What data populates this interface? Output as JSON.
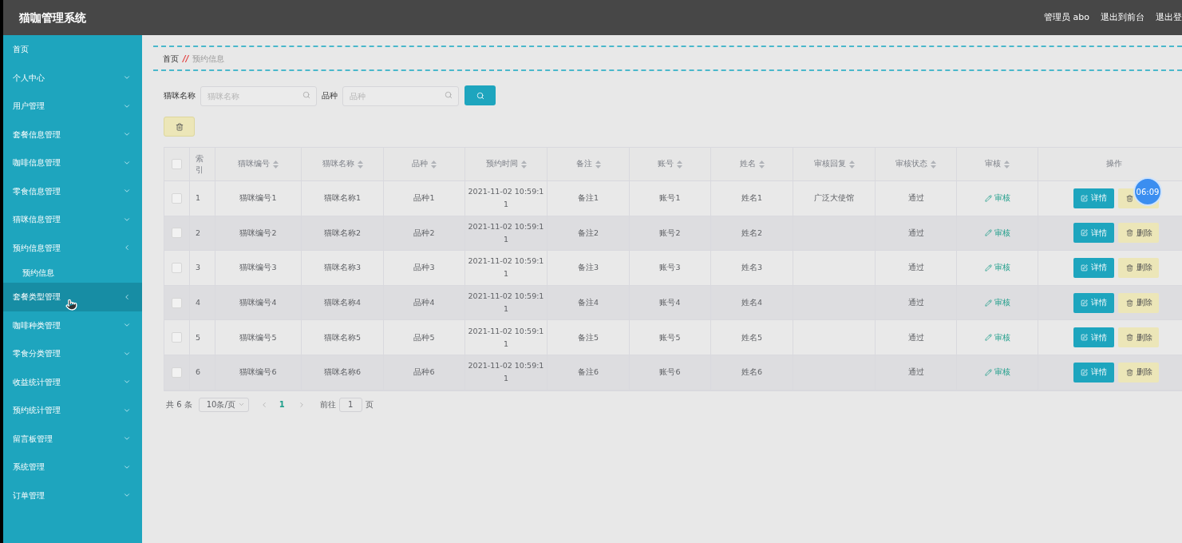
{
  "header": {
    "title": "猫咖管理系统",
    "links": [
      "管理员 abo",
      "退出到前台",
      "退出登"
    ]
  },
  "sidebar": {
    "items": [
      {
        "label": "首页",
        "expanded": false,
        "highlighted": false,
        "has_arrow": false
      },
      {
        "label": "个人中心",
        "expanded": false,
        "highlighted": false,
        "has_arrow": true
      },
      {
        "label": "用户管理",
        "expanded": false,
        "highlighted": false,
        "has_arrow": true
      },
      {
        "label": "套餐信息管理",
        "expanded": false,
        "highlighted": false,
        "has_arrow": true
      },
      {
        "label": "咖啡信息管理",
        "expanded": false,
        "highlighted": false,
        "has_arrow": true
      },
      {
        "label": "零食信息管理",
        "expanded": false,
        "highlighted": false,
        "has_arrow": true
      },
      {
        "label": "猫咪信息管理",
        "expanded": false,
        "highlighted": false,
        "has_arrow": true
      },
      {
        "label": "预约信息管理",
        "expanded": true,
        "highlighted": false,
        "has_arrow": true,
        "children": [
          {
            "label": "预约信息"
          }
        ]
      },
      {
        "label": "套餐类型管理",
        "expanded": false,
        "highlighted": true,
        "has_arrow": true
      },
      {
        "label": "咖啡种类管理",
        "expanded": false,
        "highlighted": false,
        "has_arrow": true
      },
      {
        "label": "零食分类管理",
        "expanded": false,
        "highlighted": false,
        "has_arrow": true
      },
      {
        "label": "收益统计管理",
        "expanded": false,
        "highlighted": false,
        "has_arrow": true
      },
      {
        "label": "预约统计管理",
        "expanded": false,
        "highlighted": false,
        "has_arrow": true
      },
      {
        "label": "留言板管理",
        "expanded": false,
        "highlighted": false,
        "has_arrow": true
      },
      {
        "label": "系统管理",
        "expanded": false,
        "highlighted": false,
        "has_arrow": true
      },
      {
        "label": "订单管理",
        "expanded": false,
        "highlighted": false,
        "has_arrow": true
      }
    ]
  },
  "breadcrumb": {
    "home": "首页",
    "separator": "//",
    "current": "预约信息"
  },
  "search": {
    "fields": [
      {
        "label": "猫咪名称",
        "placeholder": "猫咪名称"
      },
      {
        "label": "品种",
        "placeholder": "品种"
      }
    ]
  },
  "table": {
    "all_checked": false,
    "columns": [
      {
        "label": "索引",
        "sortable": false
      },
      {
        "label": "猫咪编号",
        "sortable": true
      },
      {
        "label": "猫咪名称",
        "sortable": true
      },
      {
        "label": "品种",
        "sortable": true
      },
      {
        "label": "预约时间",
        "sortable": true
      },
      {
        "label": "备注",
        "sortable": true
      },
      {
        "label": "账号",
        "sortable": true
      },
      {
        "label": "姓名",
        "sortable": true
      },
      {
        "label": "审核回复",
        "sortable": true
      },
      {
        "label": "审核状态",
        "sortable": true
      },
      {
        "label": "审核",
        "sortable": true
      },
      {
        "label": "操作",
        "sortable": false
      }
    ],
    "rows": [
      {
        "checked": false,
        "cells": [
          "1",
          "猫咪编号1",
          "猫咪名称1",
          "品种1",
          "2021-11-02 10:59:11",
          "备注1",
          "账号1",
          "姓名1",
          "广泛大使馆",
          "通过"
        ],
        "review": "审核",
        "actions": [
          {
            "kind": "detail",
            "label": "详情"
          },
          {
            "kind": "delete"
          }
        ]
      },
      {
        "checked": false,
        "cells": [
          "2",
          "猫咪编号2",
          "猫咪名称2",
          "品种2",
          "2021-11-02 10:59:11",
          "备注2",
          "账号2",
          "姓名2",
          "",
          "通过"
        ],
        "review": "审核",
        "actions": [
          {
            "kind": "detail",
            "label": "详情"
          },
          {
            "kind": "delete",
            "label": "删除"
          }
        ]
      },
      {
        "checked": false,
        "cells": [
          "3",
          "猫咪编号3",
          "猫咪名称3",
          "品种3",
          "2021-11-02 10:59:11",
          "备注3",
          "账号3",
          "姓名3",
          "",
          "通过"
        ],
        "review": "审核",
        "actions": [
          {
            "kind": "detail",
            "label": "详情"
          },
          {
            "kind": "delete",
            "label": "删除"
          }
        ]
      },
      {
        "checked": false,
        "cells": [
          "4",
          "猫咪编号4",
          "猫咪名称4",
          "品种4",
          "2021-11-02 10:59:11",
          "备注4",
          "账号4",
          "姓名4",
          "",
          "通过"
        ],
        "review": "审核",
        "actions": [
          {
            "kind": "detail",
            "label": "详情"
          },
          {
            "kind": "delete",
            "label": "删除"
          }
        ]
      },
      {
        "checked": false,
        "cells": [
          "5",
          "猫咪编号5",
          "猫咪名称5",
          "品种5",
          "2021-11-02 10:59:11",
          "备注5",
          "账号5",
          "姓名5",
          "",
          "通过"
        ],
        "review": "审核",
        "actions": [
          {
            "kind": "detail",
            "label": "详情"
          },
          {
            "kind": "delete",
            "label": "删除"
          }
        ]
      },
      {
        "checked": false,
        "cells": [
          "6",
          "猫咪编号6",
          "猫咪名称6",
          "品种6",
          "2021-11-02 10:59:11",
          "备注6",
          "账号6",
          "姓名6",
          "",
          "通过"
        ],
        "review": "审核",
        "actions": [
          {
            "kind": "detail",
            "label": "详情"
          },
          {
            "kind": "delete",
            "label": "删除"
          }
        ]
      }
    ]
  },
  "pagination": {
    "total": "共 6 条",
    "page_size": "10条/页",
    "current_page": "1",
    "goto_label": "前往",
    "goto_value": "1",
    "page_suffix": "页"
  },
  "clock_badge": "06:09"
}
